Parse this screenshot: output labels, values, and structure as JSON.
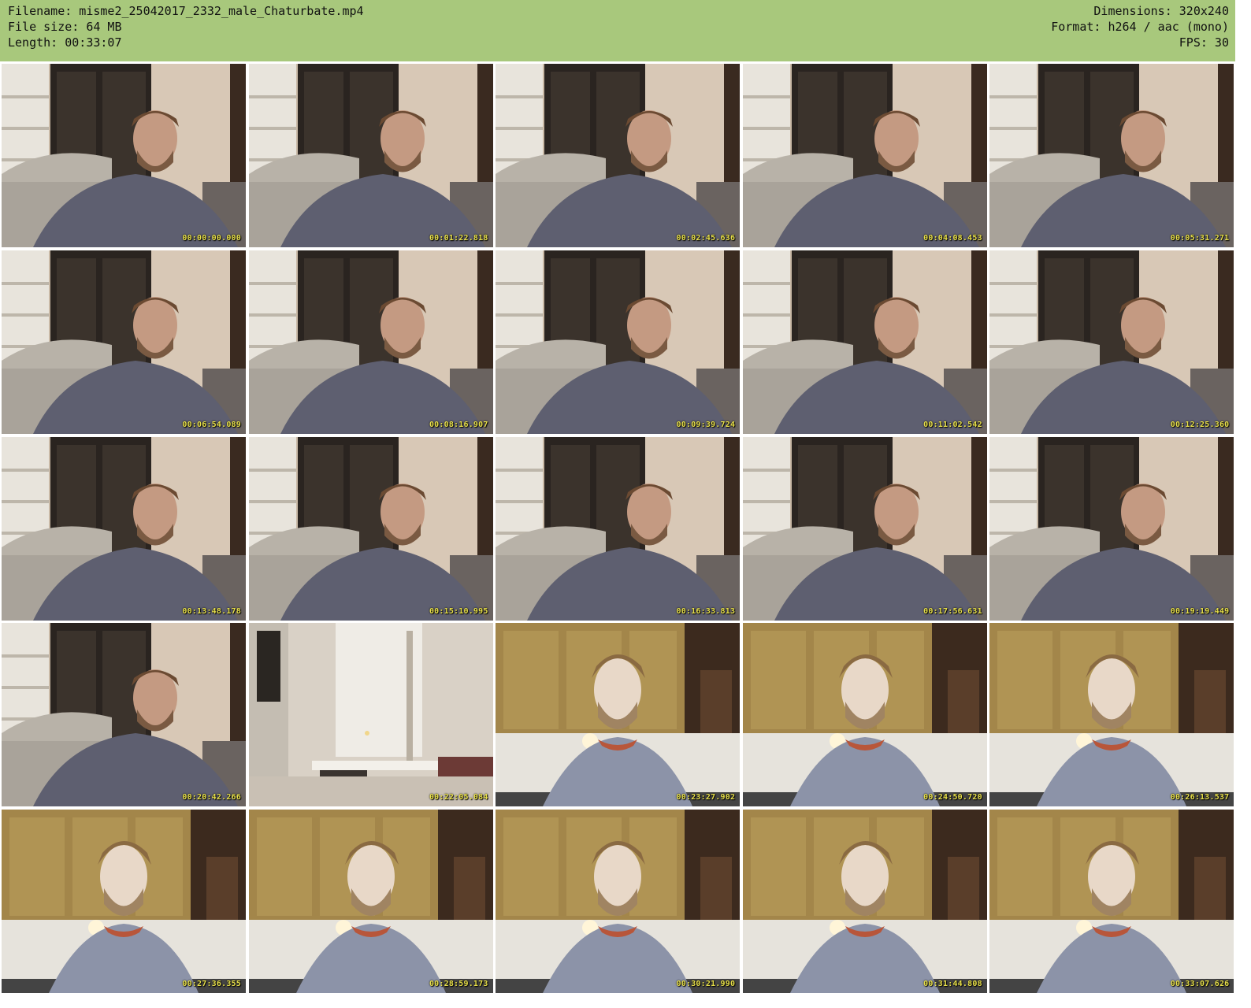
{
  "header": {
    "filename_line": "Filename: misme2_25042017_2332_male_Chaturbate.mp4",
    "filesize_line": "File size: 64 MB",
    "length_line": "Length: 00:33:07",
    "dimensions_line": "Dimensions: 320x240",
    "format_line": "Format: h264 / aac (mono)",
    "fps_line": "FPS: 30"
  },
  "colors": {
    "header_bg": "#a8c87c",
    "timestamp": "#e8e04a"
  },
  "thumbnails": [
    {
      "time": "00:00:00.000",
      "scene": "living-room"
    },
    {
      "time": "00:01:22.818",
      "scene": "living-room"
    },
    {
      "time": "00:02:45.636",
      "scene": "living-room"
    },
    {
      "time": "00:04:08.453",
      "scene": "living-room"
    },
    {
      "time": "00:05:31.271",
      "scene": "living-room"
    },
    {
      "time": "00:06:54.089",
      "scene": "living-room"
    },
    {
      "time": "00:08:16.907",
      "scene": "living-room"
    },
    {
      "time": "00:09:39.724",
      "scene": "living-room"
    },
    {
      "time": "00:11:02.542",
      "scene": "living-room"
    },
    {
      "time": "00:12:25.360",
      "scene": "living-room"
    },
    {
      "time": "00:13:48.178",
      "scene": "living-room"
    },
    {
      "time": "00:15:10.995",
      "scene": "living-room"
    },
    {
      "time": "00:16:33.813",
      "scene": "living-room"
    },
    {
      "time": "00:17:56.631",
      "scene": "living-room"
    },
    {
      "time": "00:19:19.449",
      "scene": "living-room"
    },
    {
      "time": "00:20:42.266",
      "scene": "living-room"
    },
    {
      "time": "00:22:05.084",
      "scene": "empty-room"
    },
    {
      "time": "00:23:27.902",
      "scene": "kitchen"
    },
    {
      "time": "00:24:50.720",
      "scene": "kitchen"
    },
    {
      "time": "00:26:13.537",
      "scene": "kitchen"
    },
    {
      "time": "00:27:36.355",
      "scene": "kitchen"
    },
    {
      "time": "00:28:59.173",
      "scene": "kitchen"
    },
    {
      "time": "00:30:21.990",
      "scene": "kitchen"
    },
    {
      "time": "00:31:44.808",
      "scene": "kitchen"
    },
    {
      "time": "00:33:07.626",
      "scene": "kitchen"
    }
  ]
}
